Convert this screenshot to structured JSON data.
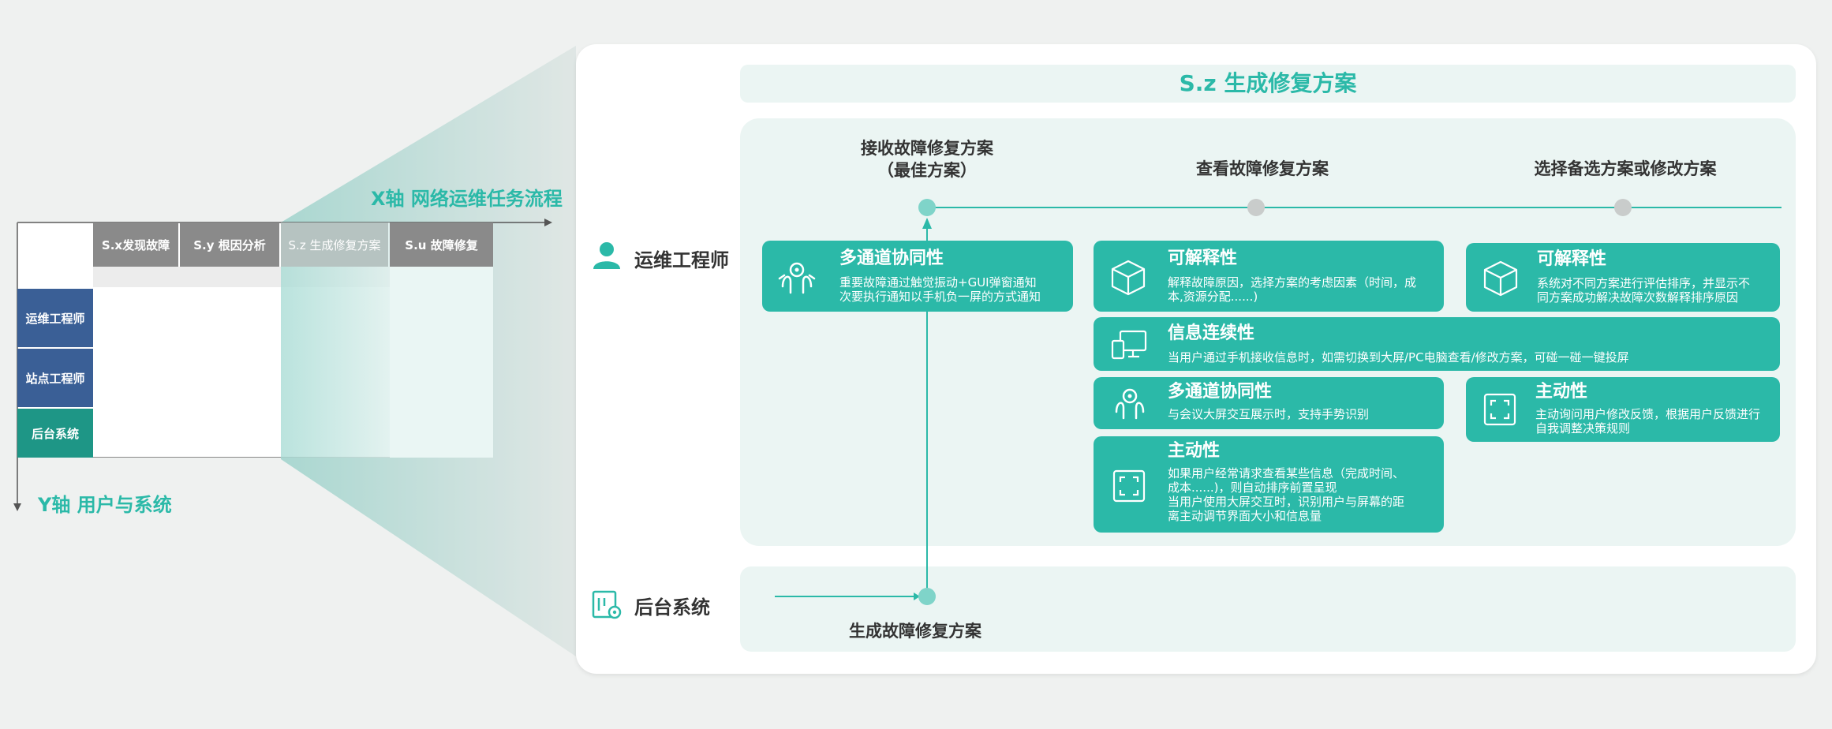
{
  "left": {
    "x_axis_label": "X轴 网络运维任务流程",
    "y_axis_label": "Y轴 用户与系统",
    "columns": [
      "S.x发现故障",
      "S.y 根因分析",
      "S.z 生成修复方案",
      "S.u 故障修复"
    ],
    "rows": [
      "运维工程师",
      "站点工程师",
      "后台系统"
    ]
  },
  "main": {
    "title": "S.z 生成修复方案",
    "actors": {
      "engineer": "运维工程师",
      "backend": "后台系统"
    },
    "steps": {
      "receive_line1": "接收故障修复方案",
      "receive_line2": "（最佳方案）",
      "view": "查看故障修复方案",
      "select": "选择备选方案或修改方案",
      "generate": "生成故障修复方案"
    },
    "cards": {
      "c1": {
        "title": "多通道协同性",
        "line1": "重要故障通过触觉振动+GUI弹窗通知",
        "line2": "次要执行通知以手机负一屏的方式通知",
        "icon": "hands-multi-channel-icon"
      },
      "c2": {
        "title": "可解释性",
        "line1": "解释故障原因，选择方案的考虑因素（时间，成",
        "line2": "本,资源分配......)",
        "icon": "cube-icon"
      },
      "c3": {
        "title": "可解释性",
        "line1": "系统对不同方案进行评估排序，并显示不",
        "line2": "同方案成功解决故障次数解释排序原因",
        "icon": "cube-icon"
      },
      "c4": {
        "title": "信息连续性",
        "line1": "当用户通过手机接收信息时，如需切换到大屏/PC电脑查看/修改方案，可碰一碰一键投屏",
        "icon": "devices-icon"
      },
      "c5": {
        "title": "多通道协同性",
        "line1": "与会议大屏交互展示时，支持手势识别",
        "icon": "hands-multi-channel-icon"
      },
      "c6": {
        "title": "主动性",
        "line1": "主动询问用户修改反馈，根据用户反馈进行",
        "line2": "自我调整决策规则",
        "icon": "expand-icon"
      },
      "c7": {
        "title": "主动性",
        "line1": "如果用户经常请求查看某些信息（完成时间、",
        "line2": "成本......)，则自动排序前置呈现",
        "line3": "当用户使用大屏交互时，识别用户与屏幕的距",
        "line4": "离主动调节界面大小和信息量",
        "icon": "expand-icon"
      }
    }
  },
  "colors": {
    "accent": "#2bb9a8",
    "blue": "#3a5f96",
    "gray_header": "#8a8a8a",
    "panel_tint": "#ebf5f3"
  }
}
